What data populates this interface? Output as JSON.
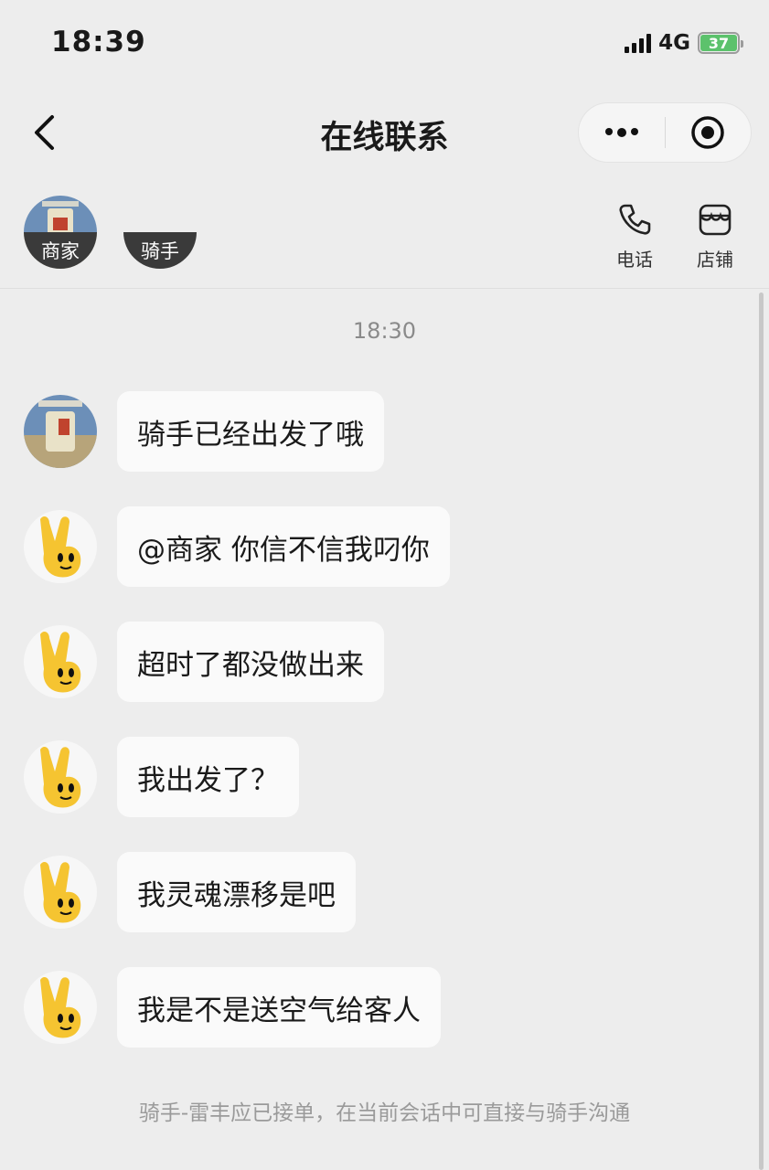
{
  "status_bar": {
    "time": "18:39",
    "network": "4G",
    "battery": "37"
  },
  "nav": {
    "title": "在线联系"
  },
  "contacts": {
    "merchant_tag": "商家",
    "rider_tag": "骑手",
    "phone_label": "电话",
    "store_label": "店铺"
  },
  "chat": {
    "timestamp": "18:30",
    "messages": [
      {
        "sender": "merchant",
        "text": "骑手已经出发了哦"
      },
      {
        "sender": "rider",
        "text": "@商家 你信不信我叼你"
      },
      {
        "sender": "rider",
        "text": "超时了都没做出来"
      },
      {
        "sender": "rider",
        "text": "我出发了？"
      },
      {
        "sender": "rider",
        "text": "我灵魂漂移是吧"
      },
      {
        "sender": "rider",
        "text": "我是不是送空气给客人"
      }
    ],
    "footer_note": "骑手-雷丰应已接单，在当前会话中可直接与骑手沟通"
  },
  "colors": {
    "background": "#ededed",
    "bubble": "#fafafa",
    "battery_green": "#5cc26c",
    "rider_avatar_yellow": "#f5c431"
  },
  "icons": [
    "back-icon",
    "more-icon",
    "close-target-icon",
    "phone-icon",
    "store-icon"
  ]
}
